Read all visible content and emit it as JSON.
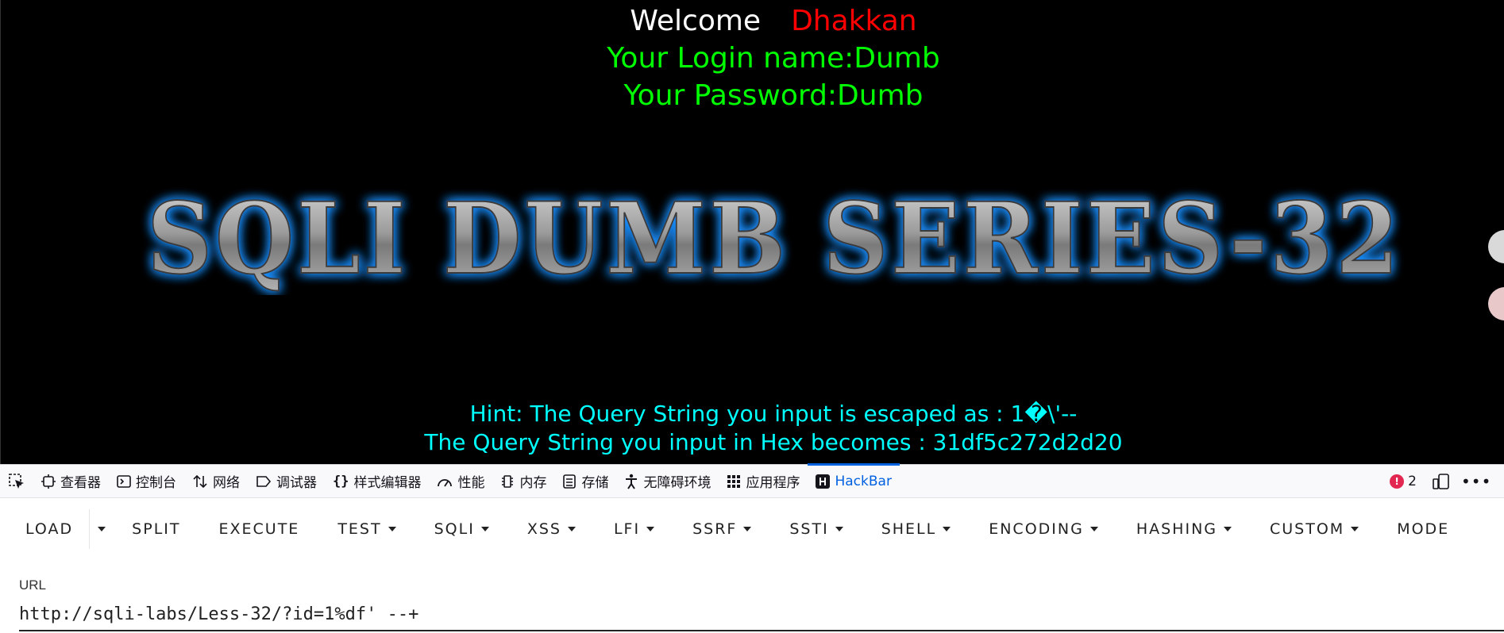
{
  "page": {
    "welcome_prefix": "Welcome",
    "welcome_user": "Dhakkan",
    "login_line": "Your Login name:Dumb",
    "password_line": "Your Password:Dumb",
    "banner_text": "SQLI DUMB SERIES-32",
    "hint_line": "Hint: The Query String you input is escaped as : 1�\\'--",
    "hex_line": "The Query String you input in Hex becomes : 31df5c272d2d20"
  },
  "devtools": {
    "tabs": [
      {
        "label": "查看器",
        "icon": "inspector-icon"
      },
      {
        "label": "控制台",
        "icon": "console-icon"
      },
      {
        "label": "网络",
        "icon": "network-icon"
      },
      {
        "label": "调试器",
        "icon": "debugger-icon"
      },
      {
        "label": "样式编辑器",
        "icon": "style-editor-icon"
      },
      {
        "label": "性能",
        "icon": "performance-icon"
      },
      {
        "label": "内存",
        "icon": "memory-icon"
      },
      {
        "label": "存储",
        "icon": "storage-icon"
      },
      {
        "label": "无障碍环境",
        "icon": "accessibility-icon"
      },
      {
        "label": "应用程序",
        "icon": "application-icon"
      },
      {
        "label": "HackBar",
        "icon": "hackbar-icon",
        "active": true
      }
    ],
    "error_count": "2",
    "accent_color": "#0061e0",
    "error_color": "#e22850"
  },
  "hackbar": {
    "buttons": [
      {
        "label": "LOAD"
      },
      {
        "label": "SPLIT"
      },
      {
        "label": "EXECUTE"
      },
      {
        "label": "TEST",
        "dropdown": true
      },
      {
        "label": "SQLI",
        "dropdown": true
      },
      {
        "label": "XSS",
        "dropdown": true
      },
      {
        "label": "LFI",
        "dropdown": true
      },
      {
        "label": "SSRF",
        "dropdown": true
      },
      {
        "label": "SSTI",
        "dropdown": true
      },
      {
        "label": "SHELL",
        "dropdown": true
      },
      {
        "label": "ENCODING",
        "dropdown": true
      },
      {
        "label": "HASHING",
        "dropdown": true
      },
      {
        "label": "CUSTOM",
        "dropdown": true
      },
      {
        "label": "MODE",
        "dropdown": false
      }
    ],
    "url_label": "URL",
    "url_value": "http://sqli-labs/Less-32/?id=1%df' --+"
  }
}
